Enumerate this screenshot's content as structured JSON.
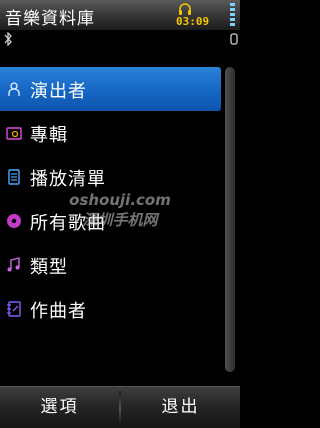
{
  "app": {
    "title": "音樂資料庫"
  },
  "status": {
    "time": "03:09",
    "headset_icon": "headset-icon",
    "battery_icon": "battery-icon"
  },
  "accent": "#1a6fcb",
  "list": [
    {
      "label": "演出者",
      "icon": "person-icon",
      "selected": true
    },
    {
      "label": "專輯",
      "icon": "album-icon",
      "selected": false
    },
    {
      "label": "播放清單",
      "icon": "playlist-icon",
      "selected": false
    },
    {
      "label": "所有歌曲",
      "icon": "disc-icon",
      "selected": false
    },
    {
      "label": "類型",
      "icon": "note-icon",
      "selected": false
    },
    {
      "label": "作曲者",
      "icon": "composer-icon",
      "selected": false
    }
  ],
  "watermark": {
    "line1": "oshouji.com",
    "line2": "深圳手机网"
  },
  "softkeys": {
    "left": "選項",
    "right": "退出"
  }
}
